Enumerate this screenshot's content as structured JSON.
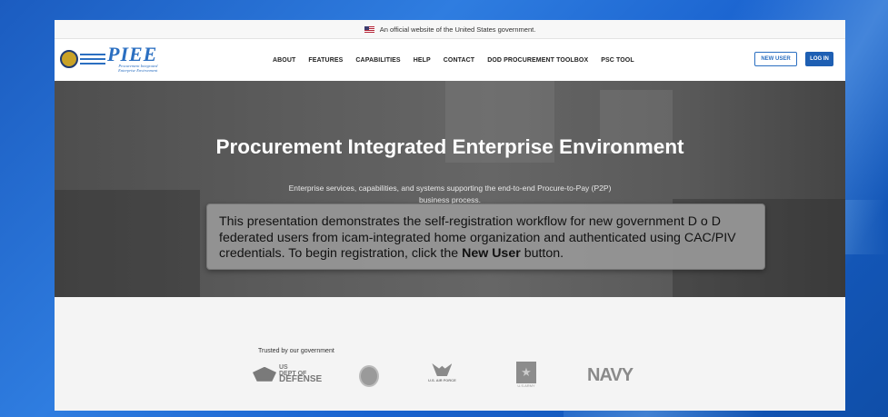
{
  "gov_banner": {
    "text": "An official website of the United States government."
  },
  "logo": {
    "title": "PIEE",
    "subtitle_line1": "Procurement Integrated",
    "subtitle_line2": "Enterprise Environment"
  },
  "nav": {
    "items": [
      "ABOUT",
      "FEATURES",
      "CAPABILITIES",
      "HELP",
      "CONTACT",
      "DOD PROCUREMENT TOOLBOX",
      "PSC TOOL"
    ],
    "new_user_label": "NEW USER",
    "login_label": "LOG IN"
  },
  "hero": {
    "title": "Procurement Integrated Enterprise Environment",
    "subtitle_line1": "Enterprise services, capabilities, and systems supporting the end-to-end Procure-to-Pay (P2P)",
    "subtitle_line2": "business process."
  },
  "tooltip": {
    "text_line1": "This presentation demonstrates the self-registration workflow for new government D o D",
    "text_line2": "federated users from icam-integrated home organization and authenticated using CAC/PIV",
    "text_line3_pre": "credentials. To begin registration, click the ",
    "text_bold": "New User",
    "text_line3_post": " button."
  },
  "trusted": {
    "label": "Trusted by our government",
    "partners": {
      "dod_line1": "US",
      "dod_line2": "DEPT OF",
      "dod_line3": "DEFENSE",
      "airforce": "U.S. AIR FORCE",
      "army": "U.S.ARMY",
      "navy": "NAVY"
    }
  },
  "colors": {
    "accent": "#1e5fb3",
    "desktop_bg": "#2f7de0",
    "hero_bg": "#5c5c5c"
  }
}
